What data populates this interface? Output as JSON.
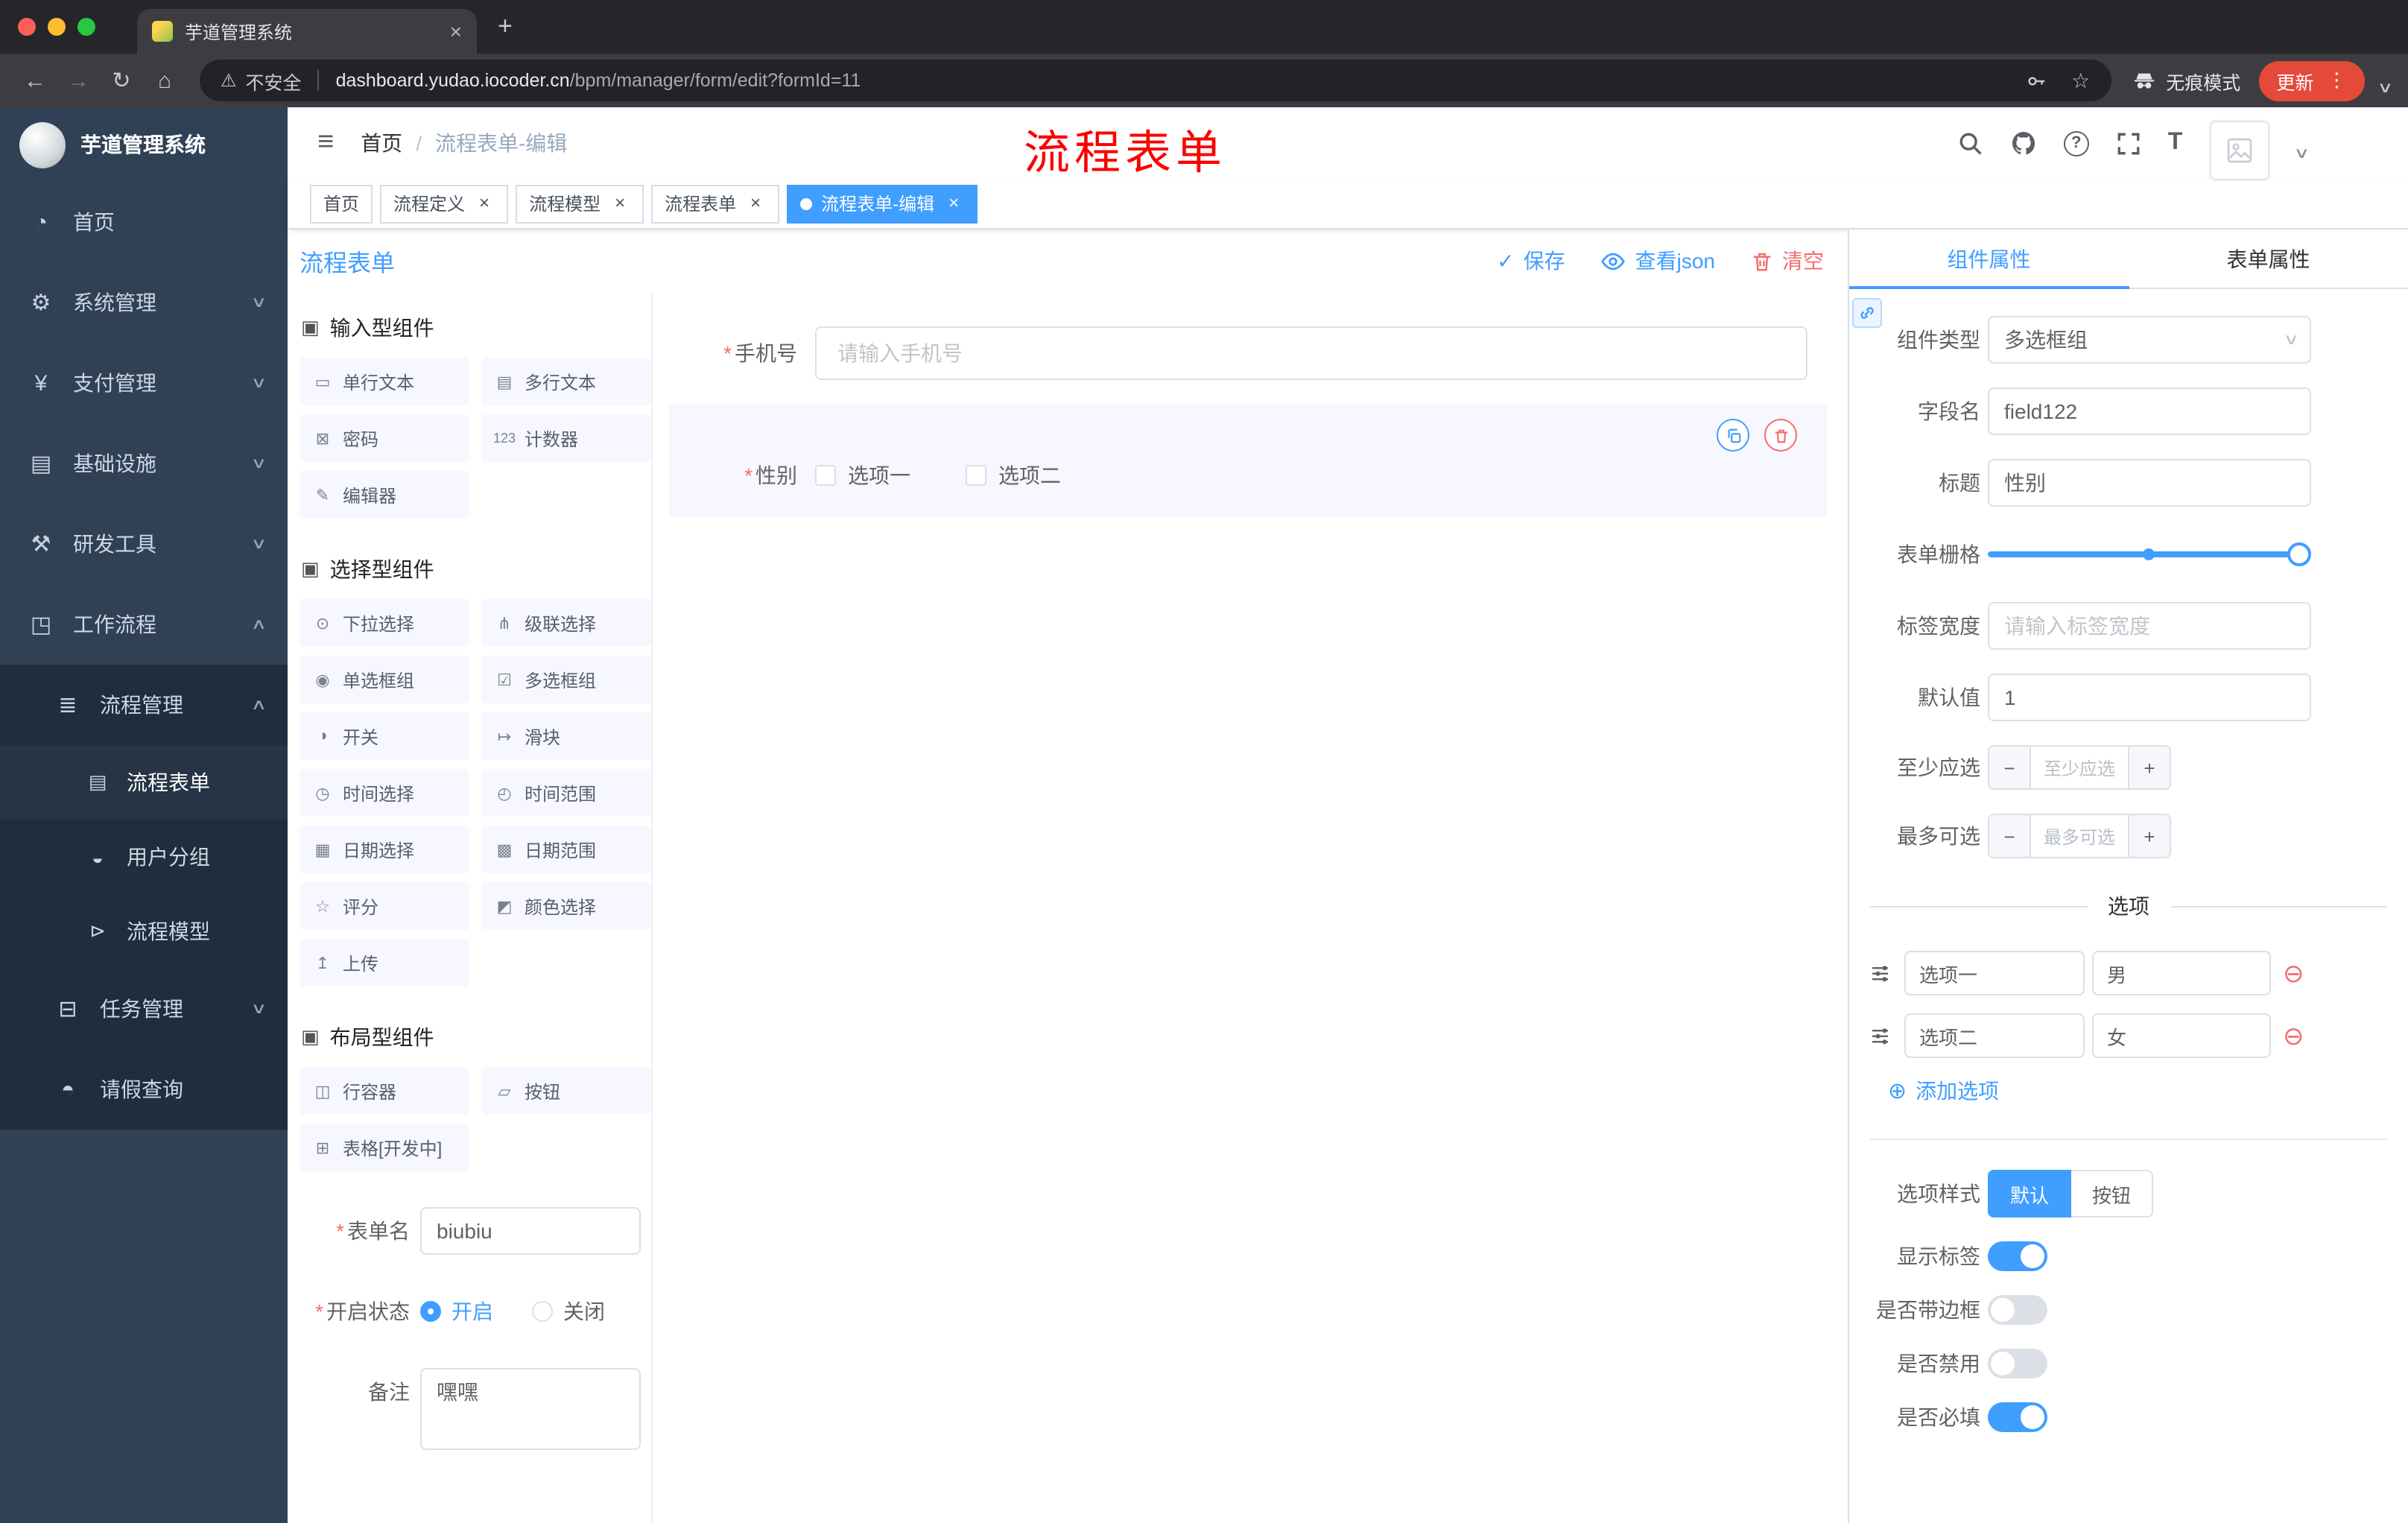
{
  "glyphs": {
    "back": "←",
    "forward": "→",
    "reload": "↻",
    "home": "⌂",
    "warning": "⚠",
    "star": "☆",
    "dots": "⋮",
    "chevron_down": "∨",
    "chevron_up": "∧",
    "close": "×",
    "plus": "+",
    "minus": "−",
    "hamburger": "≡",
    "slash": "/",
    "help": "?",
    "font_size": "T",
    "check": "✓",
    "required": "*",
    "add_circle": "⊕",
    "remove_circle": "⊖"
  },
  "browser": {
    "tab_title": "芋道管理系统",
    "security_label": "不安全",
    "url_host": "dashboard.yudao.iocoder.cn",
    "url_path": "/bpm/manager/form/edit?formId=11",
    "incognito_label": "无痕模式",
    "update_label": "更新"
  },
  "header": {
    "logo_title": "芋道管理系统",
    "breadcrumb_home": "首页",
    "breadcrumb_current": "流程表单-编辑",
    "annotation": "流程表单"
  },
  "tags": [
    {
      "label": "首页",
      "active": false,
      "closable": false
    },
    {
      "label": "流程定义",
      "active": false,
      "closable": true
    },
    {
      "label": "流程模型",
      "active": false,
      "closable": true
    },
    {
      "label": "流程表单",
      "active": false,
      "closable": true
    },
    {
      "label": "流程表单-编辑",
      "active": true,
      "closable": true
    }
  ],
  "sidebar": {
    "items": [
      {
        "label": "首页",
        "glyph": "◔"
      },
      {
        "label": "系统管理",
        "glyph": "⚙",
        "arrow": "∨"
      },
      {
        "label": "支付管理",
        "glyph": "¥",
        "arrow": "∨"
      },
      {
        "label": "基础设施",
        "glyph": "▤",
        "arrow": "∨"
      },
      {
        "label": "研发工具",
        "glyph": "⚒",
        "arrow": "∨"
      },
      {
        "label": "工作流程",
        "glyph": "◳",
        "arrow": "∧"
      }
    ],
    "sub": [
      {
        "label": "流程管理",
        "glyph": "≣",
        "arrow": "∧"
      },
      {
        "label": "流程表单",
        "glyph": "▤",
        "active": true
      },
      {
        "label": "用户分组",
        "glyph": "◒"
      },
      {
        "label": "流程模型",
        "glyph": "⊳"
      },
      {
        "label": "任务管理",
        "glyph": "⊟",
        "arrow": "∨"
      },
      {
        "label": "请假查询",
        "glyph": "◓"
      }
    ]
  },
  "designer": {
    "title": "流程表单",
    "actions": {
      "save": "保存",
      "view_json": "查看json",
      "clear": "清空"
    },
    "groups": [
      {
        "title": "输入型组件",
        "glyph": "▣",
        "items": [
          {
            "label": "单行文本",
            "glyph": "▭"
          },
          {
            "label": "多行文本",
            "glyph": "▤"
          },
          {
            "label": "密码",
            "glyph": "⊠"
          },
          {
            "label": "计数器",
            "glyph": "123"
          },
          {
            "label": "编辑器",
            "glyph": "✎"
          }
        ]
      },
      {
        "title": "选择型组件",
        "glyph": "▣",
        "items": [
          {
            "label": "下拉选择",
            "glyph": "⊙"
          },
          {
            "label": "级联选择",
            "glyph": "⋔"
          },
          {
            "label": "单选框组",
            "glyph": "◉"
          },
          {
            "label": "多选框组",
            "glyph": "☑"
          },
          {
            "label": "开关",
            "glyph": "◑"
          },
          {
            "label": "滑块",
            "glyph": "↦"
          },
          {
            "label": "时间选择",
            "glyph": "◷"
          },
          {
            "label": "时间范围",
            "glyph": "◴"
          },
          {
            "label": "日期选择",
            "glyph": "▦"
          },
          {
            "label": "日期范围",
            "glyph": "▩"
          },
          {
            "label": "评分",
            "glyph": "☆"
          },
          {
            "label": "颜色选择",
            "glyph": "◩"
          },
          {
            "label": "上传",
            "glyph": "↥"
          }
        ]
      },
      {
        "title": "布局型组件",
        "glyph": "▣",
        "items": [
          {
            "label": "行容器",
            "glyph": "◫"
          },
          {
            "label": "按钮",
            "glyph": "▱"
          },
          {
            "label": "表格[开发中]",
            "glyph": "⊞"
          }
        ]
      }
    ],
    "meta": {
      "name_label": "表单名",
      "name_value": "biubiu",
      "status_label": "开启状态",
      "status_on": "开启",
      "status_off": "关闭",
      "status_selected": "开启",
      "remark_label": "备注",
      "remark_value": "嘿嘿"
    },
    "canvas": {
      "phone": {
        "label": "手机号",
        "required": true,
        "placeholder": "请输入手机号"
      },
      "gender": {
        "label": "性别",
        "required": true,
        "options": [
          "选项一",
          "选项二"
        ],
        "selected": true
      }
    }
  },
  "panel": {
    "tabs": {
      "component": "组件属性",
      "form": "表单属性",
      "active": "组件属性"
    },
    "component_type": {
      "label": "组件类型",
      "value": "多选框组"
    },
    "field_name": {
      "label": "字段名",
      "value": "field122"
    },
    "title": {
      "label": "标题",
      "value": "性别"
    },
    "grid": {
      "label": "表单栅格",
      "percent": 100,
      "mark_percent": 48
    },
    "label_width": {
      "label": "标签宽度",
      "placeholder": "请输入标签宽度"
    },
    "default_value": {
      "label": "默认值",
      "value": "1"
    },
    "min_select": {
      "label": "至少应选",
      "placeholder": "至少应选"
    },
    "max_select": {
      "label": "最多可选",
      "placeholder": "最多可选"
    },
    "options": {
      "divider": "选项",
      "rows": [
        {
          "label": "选项一",
          "value": "男"
        },
        {
          "label": "选项二",
          "value": "女"
        }
      ],
      "add_label": "添加选项"
    },
    "option_style": {
      "label": "选项样式",
      "default": "默认",
      "button": "按钮",
      "selected": "默认"
    },
    "toggles": [
      {
        "label": "显示标签",
        "on": true
      },
      {
        "label": "是否带边框",
        "on": false
      },
      {
        "label": "是否禁用",
        "on": false
      },
      {
        "label": "是否必填",
        "on": true
      }
    ]
  },
  "colors": {
    "accent": "#409eff",
    "danger": "#f56c6c",
    "annotation_red": "#fb0200",
    "sidebar_bg": "#304156",
    "submenu_bg": "#1f2d3d",
    "update_pill": "#e5493a"
  }
}
